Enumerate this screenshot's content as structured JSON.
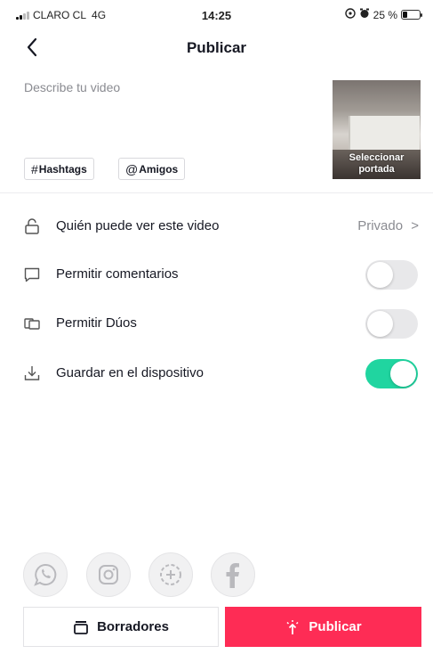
{
  "status_bar": {
    "carrier": "CLARO CL",
    "network": "4G",
    "time": "14:25",
    "battery": "25 %",
    "battery_level": 0.25
  },
  "header": {
    "title": "Publicar",
    "back_icon": "chevron-left-icon"
  },
  "description": {
    "placeholder": "Describe tu video"
  },
  "tags": [
    {
      "symbol": "#",
      "label": "Hashtags"
    },
    {
      "symbol": "@",
      "label": "Amigos"
    }
  ],
  "cover": {
    "label_line1": "Seleccionar",
    "label_line2": "portada"
  },
  "settings": {
    "privacy": {
      "icon": "lock-icon",
      "label": "Quién puede ver este video",
      "value": "Privado",
      "chevron": ">"
    },
    "comments": {
      "icon": "comment-icon",
      "label": "Permitir comentarios",
      "enabled": false
    },
    "duets": {
      "icon": "duet-icon",
      "label": "Permitir Dúos",
      "enabled": false
    },
    "save": {
      "icon": "download-icon",
      "label": "Guardar en el dispositivo",
      "enabled": true
    }
  },
  "share_targets": [
    "whatsapp-icon",
    "instagram-icon",
    "add-circle-icon",
    "facebook-icon"
  ],
  "buttons": {
    "drafts": "Borradores",
    "publish": "Publicar"
  },
  "colors": {
    "accent": "#fe2c55",
    "toggle_on": "#20d5a0",
    "secondary_text": "#8a8b91"
  }
}
